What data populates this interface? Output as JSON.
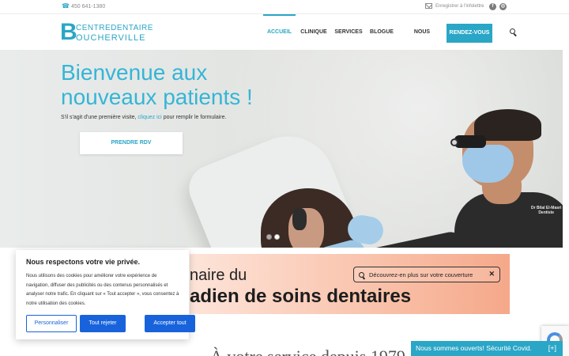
{
  "topbar": {
    "phone": "450 641-1380",
    "newsletter": "Enregistrer à l'infolettre",
    "social": [
      "f",
      "◎"
    ]
  },
  "logo": {
    "letter": "B",
    "line1": "CENTREDENTAIRE",
    "line2": "OUCHERVILLE"
  },
  "nav": {
    "items": [
      "ACCUEIL",
      "CLINIQUE",
      "SERVICES",
      "BLOGUE",
      "NOUS JOINDRE"
    ],
    "cta": "RENDEZ-VOUS"
  },
  "hero": {
    "title_line1": "Bienvenue aux",
    "title_line2": "nouveaux patients !",
    "sub_before": "S'il s'agit d'une première visite, ",
    "sub_link": "cliquez ici",
    "sub_after": " pour remplir le formulaire.",
    "button": "PRENDRE RDV",
    "doctor_name_line1": "Dr Bilal El-Masri",
    "doctor_name_line2": "Dentiste"
  },
  "banner": {
    "line1": "naire du",
    "line2": "adien de soins dentaires",
    "pill": "Découvrez-en plus sur votre couverture",
    "close": "✕"
  },
  "section": {
    "heading": "À votre service depuis 1979"
  },
  "cookie": {
    "title": "Nous respectons votre vie privée.",
    "text": "Nous utilisons des cookies pour améliorer votre expérience de navigation, diffuser des publicités ou des contenus personnalisés et analyser notre trafic. En cliquant sur « Tout accepter », vous consentez à notre utilisation des cookies.",
    "btn_customize": "Personnaliser",
    "btn_reject": "Tout rejeter",
    "btn_accept": "Accepter tout"
  },
  "covid": {
    "label": "Nous sommes ouverts! Sécurité Covid.",
    "plus": "[+]"
  },
  "colors": {
    "accent": "#2aa6c6",
    "cookie_button": "#1863dc"
  }
}
